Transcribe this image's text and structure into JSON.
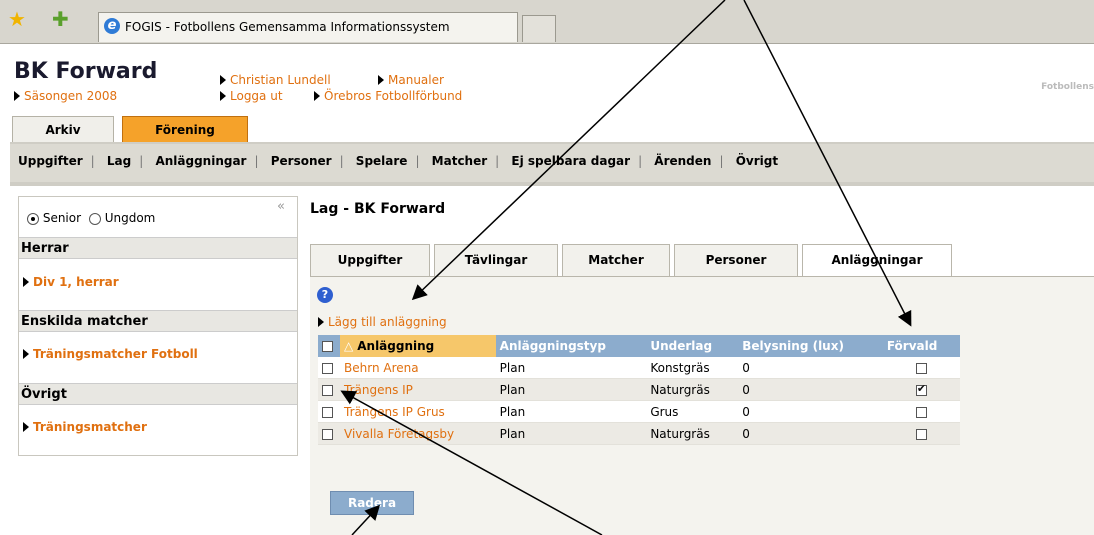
{
  "browser": {
    "tab_title": "FOGIS - Fotbollens Gemensamma Informationssystem"
  },
  "header": {
    "club_name": "BK Forward",
    "season": "Säsongen 2008",
    "user_link": "Christian Lundell",
    "manuals_link": "Manualer",
    "logout_link": "Logga ut",
    "district_link": "Örebros Fotbollförbund",
    "federation_text": "Fotbollens"
  },
  "main_tabs": [
    "Arkiv",
    "Förening"
  ],
  "menu": [
    "Uppgifter",
    "Lag",
    "Anläggningar",
    "Personer",
    "Spelare",
    "Matcher",
    "Ej spelbara dagar",
    "Ärenden",
    "Övrigt"
  ],
  "sidebar": {
    "radio_senior": "Senior",
    "radio_ungdom": "Ungdom",
    "collapse": "«",
    "sections": [
      {
        "title": "Herrar",
        "item": "Div 1, herrar"
      },
      {
        "title": "Enskilda matcher",
        "item": "Träningsmatcher Fotboll"
      },
      {
        "title": "Övrigt",
        "item": "Träningsmatcher"
      }
    ]
  },
  "content": {
    "page_title": "Lag - BK Forward",
    "tabs": [
      "Uppgifter",
      "Tävlingar",
      "Matcher",
      "Personer",
      "Anläggningar"
    ],
    "help_icon": "?",
    "add_link": "Lägg till anläggning",
    "columns": [
      "Anläggning",
      "Anläggningstyp",
      "Underlag",
      "Belysning (lux)",
      "Förvald"
    ],
    "sort_marker": "△",
    "rows": [
      {
        "name": "Behrn Arena",
        "type": "Plan",
        "surface": "Konstgräs",
        "lux": "0",
        "default": false
      },
      {
        "name": "Trängens IP",
        "type": "Plan",
        "surface": "Naturgräs",
        "lux": "0",
        "default": true
      },
      {
        "name": "Trängens IP Grus",
        "type": "Plan",
        "surface": "Grus",
        "lux": "0",
        "default": false
      },
      {
        "name": "Vivalla Företagsby",
        "type": "Plan",
        "surface": "Naturgräs",
        "lux": "0",
        "default": false
      }
    ],
    "delete_button": "Radera"
  },
  "colors": {
    "accent_orange": "#e07010",
    "tab_active": "#f5a22a",
    "table_header": "#8caccd",
    "sorted_header": "#f6c76a"
  }
}
